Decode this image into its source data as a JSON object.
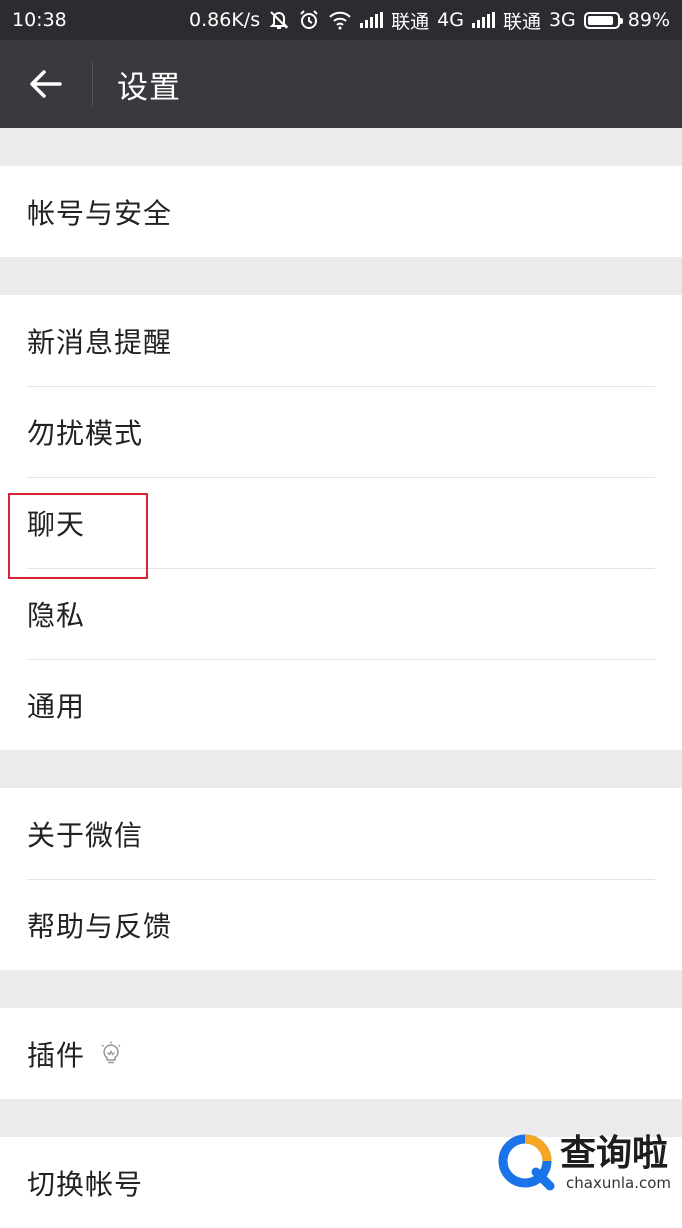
{
  "status_bar": {
    "time": "10:38",
    "speed": "0.86K/s",
    "carrier1": "联通",
    "network1": "4G",
    "carrier2": "联通",
    "network2": "3G",
    "battery_text": "89%",
    "battery_level": 0.89,
    "icons": [
      "mute-icon",
      "alarm-icon",
      "wifi-icon",
      "signal-icon",
      "signal-icon",
      "battery-icon"
    ]
  },
  "toolbar": {
    "back_icon": "arrow-left-icon",
    "title": "设置"
  },
  "groups": [
    {
      "items": [
        {
          "label": "帐号与安全"
        }
      ]
    },
    {
      "items": [
        {
          "label": "新消息提醒"
        },
        {
          "label": "勿扰模式"
        },
        {
          "label": "聊天"
        },
        {
          "label": "隐私"
        },
        {
          "label": "通用"
        }
      ]
    },
    {
      "items": [
        {
          "label": "关于微信"
        },
        {
          "label": "帮助与反馈"
        }
      ]
    },
    {
      "items": [
        {
          "label": "插件",
          "icon": "lightbulb-icon"
        }
      ]
    },
    {
      "items": [
        {
          "label": "切换帐号"
        }
      ]
    }
  ],
  "highlight": {
    "target": "通用",
    "color": "#d9252f"
  },
  "watermark": {
    "cn": "查询啦",
    "en": "chaxunla.com"
  },
  "colors": {
    "toolbar_bg": "#393a3f",
    "statusbar_bg": "#2b2c30",
    "page_bg": "#ebebeb",
    "accent_blue": "#1a73e8",
    "accent_orange": "#f5a623"
  }
}
